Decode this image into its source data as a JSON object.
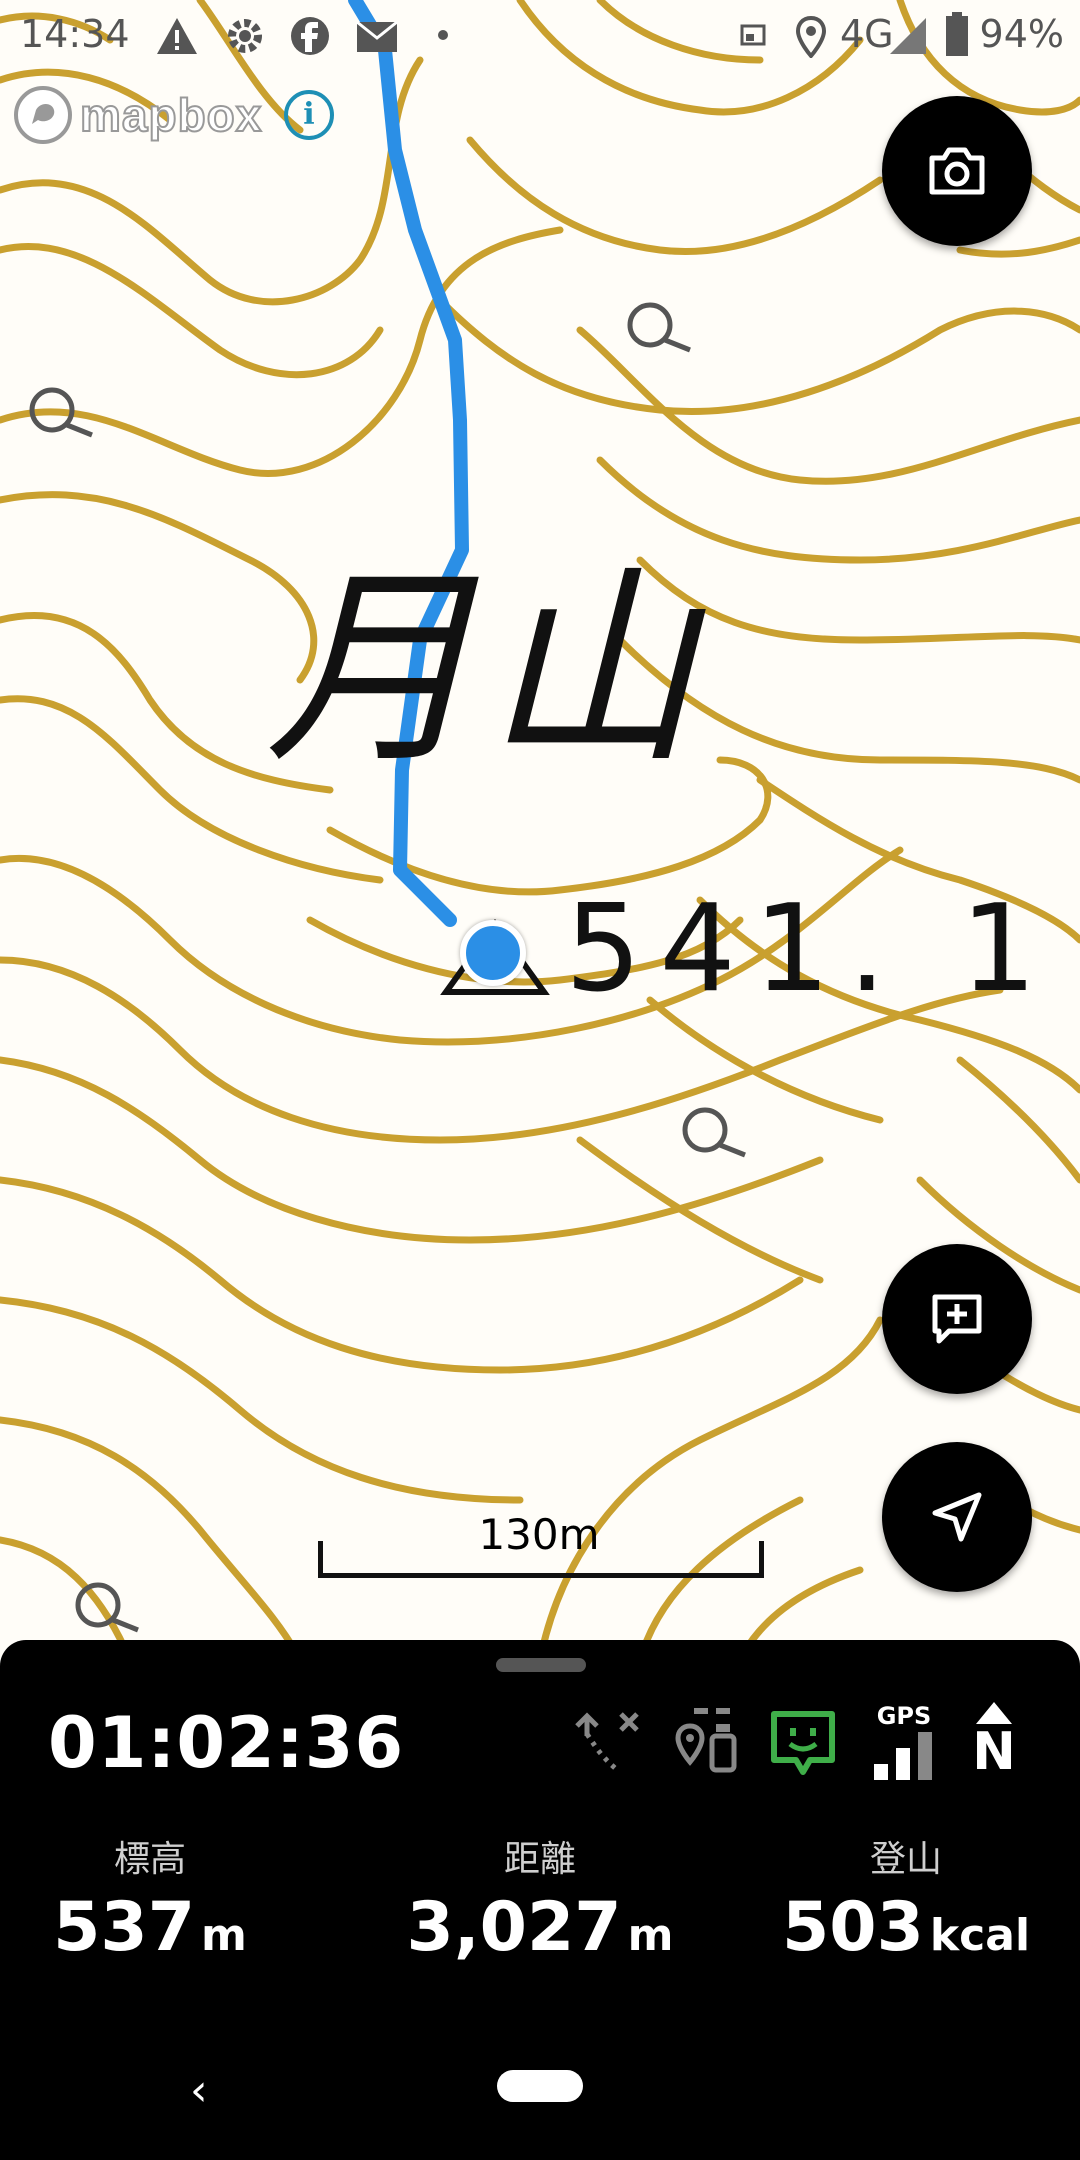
{
  "status_bar": {
    "time": "14:34",
    "network": "4G",
    "battery": "94%",
    "icons": [
      "warning-icon",
      "settings-icon",
      "facebook-icon",
      "mail-icon",
      "dot-icon",
      "cast-icon",
      "location-pin-icon",
      "signal-icon",
      "battery-icon"
    ]
  },
  "map": {
    "attribution": "mapbox",
    "peak_name": "月山",
    "peak_height": "541. 1",
    "scale_label": "130m",
    "contour_color": "#c9a02f",
    "track_color": "#2b8fe6"
  },
  "buttons": {
    "camera": "camera-icon",
    "add_note": "add-note-icon",
    "locate": "navigation-arrow-icon"
  },
  "panel": {
    "elapsed_time": "01:02:36",
    "gps_label": "GPS",
    "compass_label": "N",
    "stats": [
      {
        "label": "標高",
        "value": "537",
        "unit": "m"
      },
      {
        "label": "距離",
        "value": "3,027",
        "unit": "m"
      },
      {
        "label": "登山",
        "value": "503",
        "unit": "kcal"
      }
    ]
  },
  "nav": {
    "back": "‹"
  }
}
